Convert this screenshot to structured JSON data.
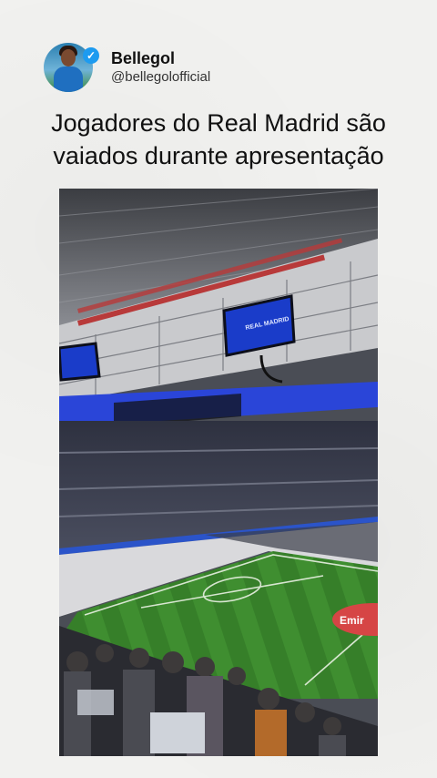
{
  "post": {
    "author_name": "Bellegol",
    "author_handle": "@bellegolofficial",
    "verified_icon": "verified-badge-icon",
    "headline_line1": "Jogadores do Real Madrid são",
    "headline_line2": "vaiados durante apresentação"
  },
  "photo": {
    "screen_text": "REAL MADRID",
    "ad_text": "Emir",
    "description": "stadium-interior"
  },
  "colors": {
    "background": "#f1f1ef",
    "pitch": "#3c8a2e",
    "screen": "#1a3cc9",
    "verified": "#1d9bf0"
  }
}
